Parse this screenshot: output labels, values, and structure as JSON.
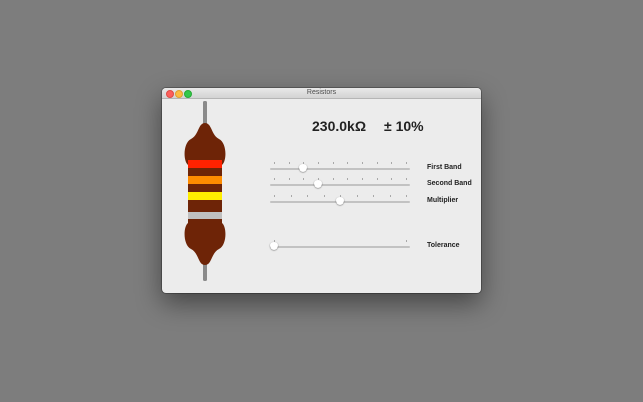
{
  "window": {
    "title": "Resistors"
  },
  "readout": {
    "value": "230.0kΩ",
    "tolerance": "± 10%"
  },
  "bands": {
    "first": "#ff2200",
    "second": "#ff8c00",
    "multiplier": "#ffee00",
    "tolerance": "#c0c0c0",
    "body": "#6e2407",
    "lead": "#8a8a8a"
  },
  "sliders": [
    {
      "name": "first-band",
      "label": "First Band",
      "value": 2,
      "max": 9,
      "ticks": 10
    },
    {
      "name": "second-band",
      "label": "Second Band",
      "value": 3,
      "max": 9,
      "ticks": 10
    },
    {
      "name": "multiplier",
      "label": "Multiplier",
      "value": 4,
      "max": 8,
      "ticks": 9
    },
    {
      "name": "tolerance",
      "label": "Tolerance",
      "value": 0,
      "max": 1,
      "ticks": 2
    }
  ]
}
